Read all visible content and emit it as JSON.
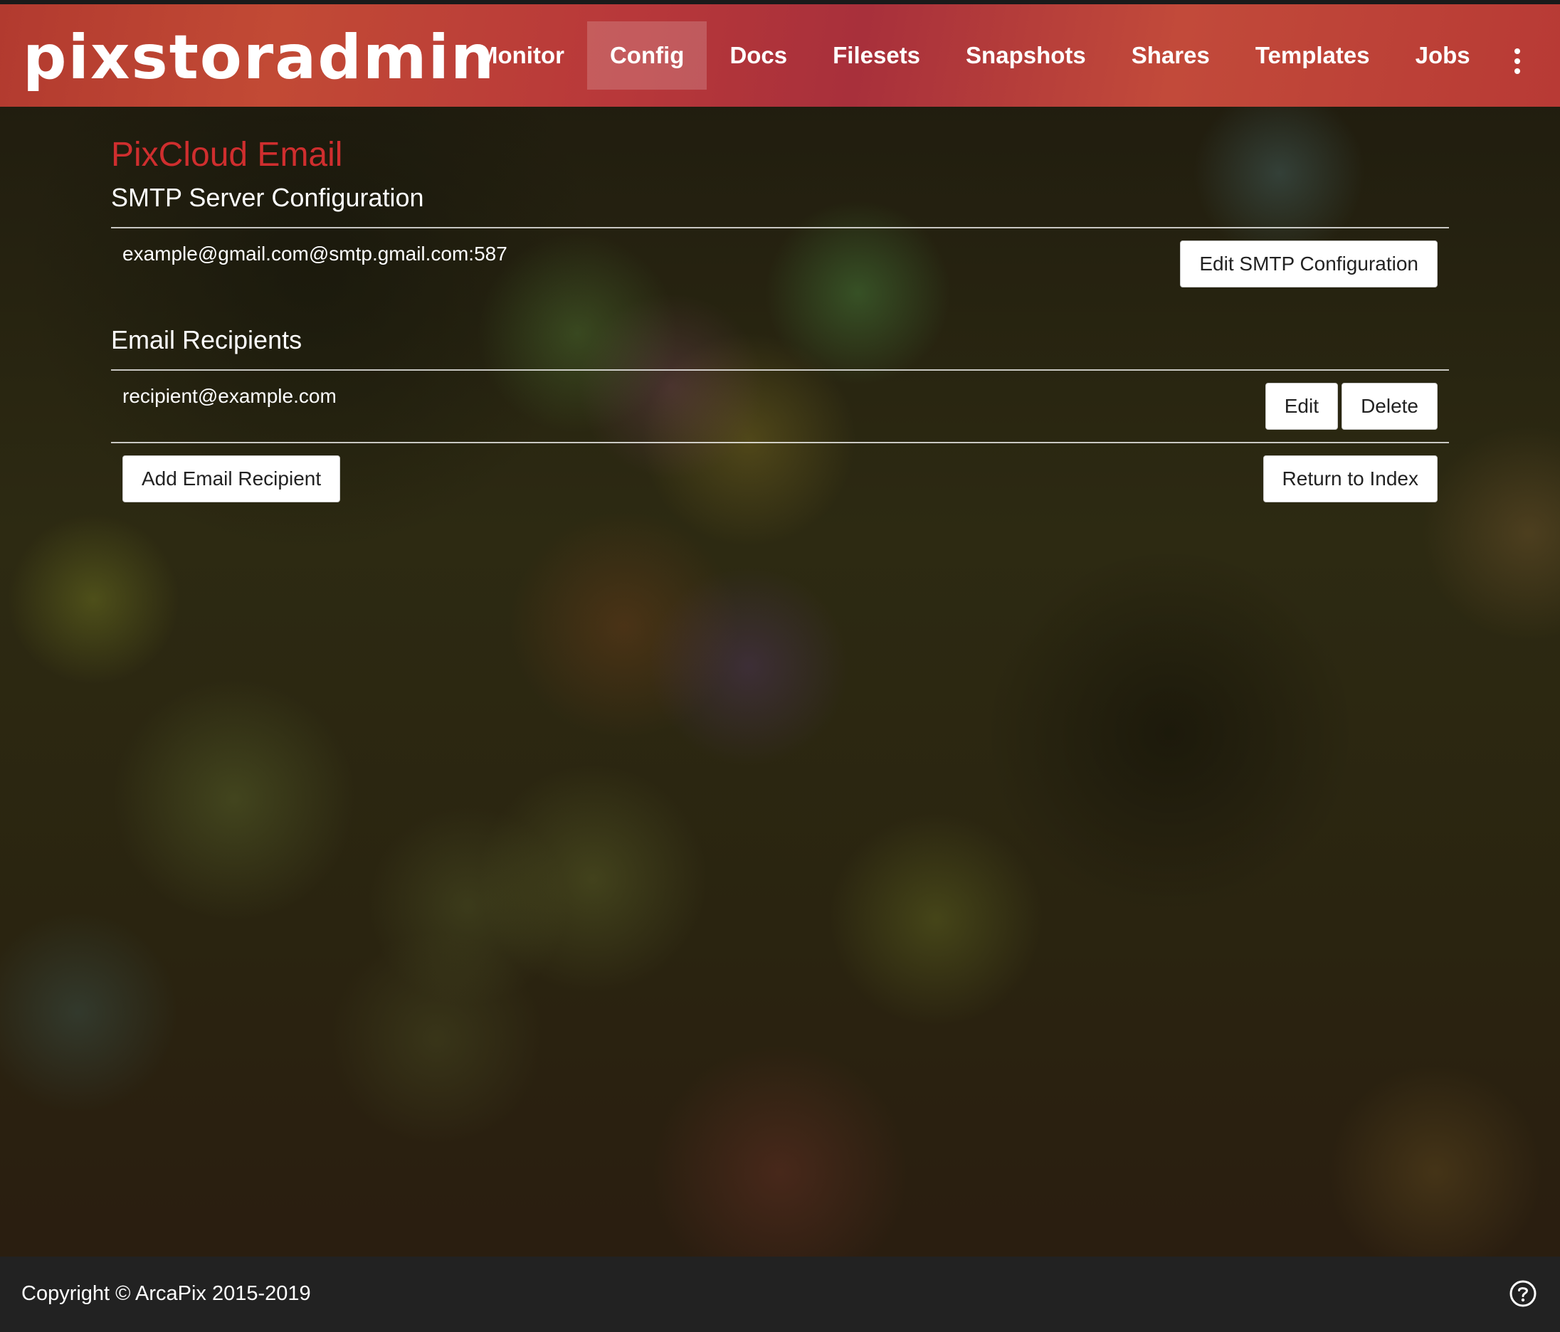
{
  "header": {
    "brand": "pixstoradmin",
    "nav": [
      {
        "label": "Monitor",
        "active": false
      },
      {
        "label": "Config",
        "active": true
      },
      {
        "label": "Docs",
        "active": false
      },
      {
        "label": "Filesets",
        "active": false
      },
      {
        "label": "Snapshots",
        "active": false
      },
      {
        "label": "Shares",
        "active": false
      },
      {
        "label": "Templates",
        "active": false
      },
      {
        "label": "Jobs",
        "active": false
      }
    ],
    "more_icon": "kebab-vertical-icon"
  },
  "page": {
    "title": "PixCloud Email",
    "smtp": {
      "heading": "SMTP Server Configuration",
      "value": "example@gmail.com@smtp.gmail.com:587",
      "edit_label": "Edit SMTP Configuration"
    },
    "recipients": {
      "heading": "Email Recipients",
      "items": [
        {
          "email": "recipient@example.com",
          "edit_label": "Edit",
          "delete_label": "Delete"
        }
      ],
      "add_label": "Add Email Recipient",
      "return_label": "Return to Index"
    }
  },
  "footer": {
    "copyright": "Copyright © ArcaPix 2015-2019",
    "help_icon": "question-circle-icon"
  },
  "colors": {
    "header_red": "#b8383a",
    "title_red": "#cf2e2e",
    "footer_bg": "#222222"
  }
}
